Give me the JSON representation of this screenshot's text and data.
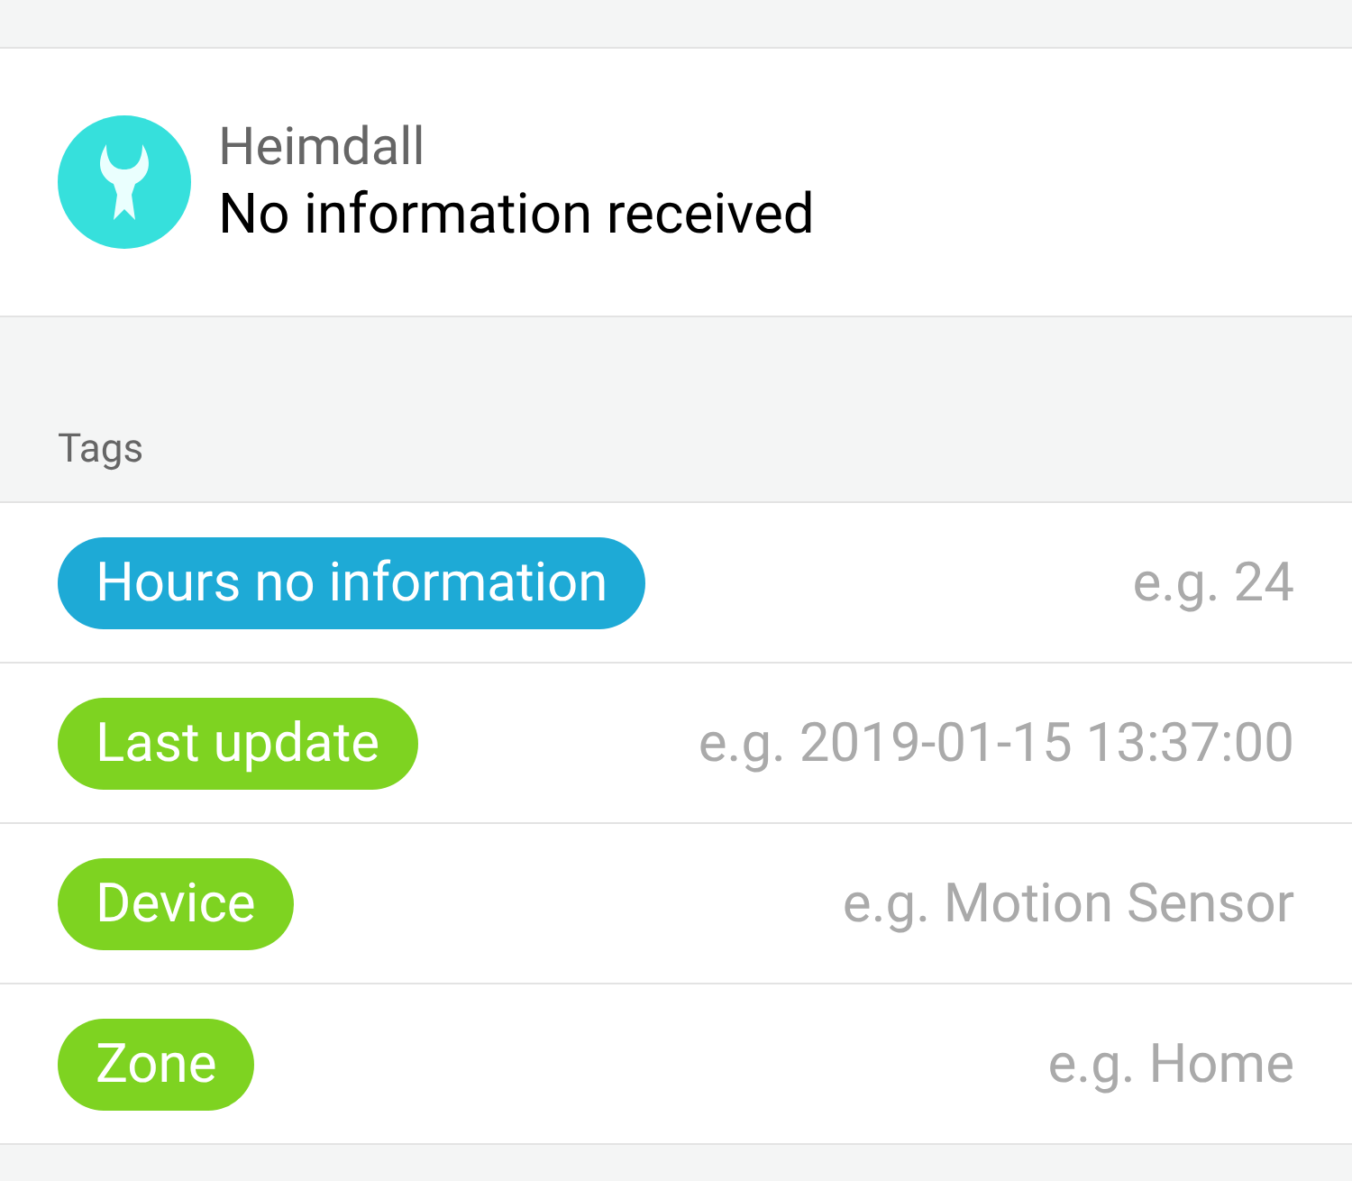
{
  "app": {
    "name": "Heimdall",
    "status": "No information received"
  },
  "tags_section": {
    "title": "Tags"
  },
  "tags": [
    {
      "label": "Hours no information",
      "color": "#1eaad6",
      "placeholder": "e.g. 24"
    },
    {
      "label": "Last update",
      "color": "#7ed321",
      "placeholder": "e.g. 2019-01-15 13:37:00"
    },
    {
      "label": "Device",
      "color": "#7ed321",
      "placeholder": "e.g. Motion Sensor"
    },
    {
      "label": "Zone",
      "color": "#7ed321",
      "placeholder": "e.g. Home"
    }
  ]
}
